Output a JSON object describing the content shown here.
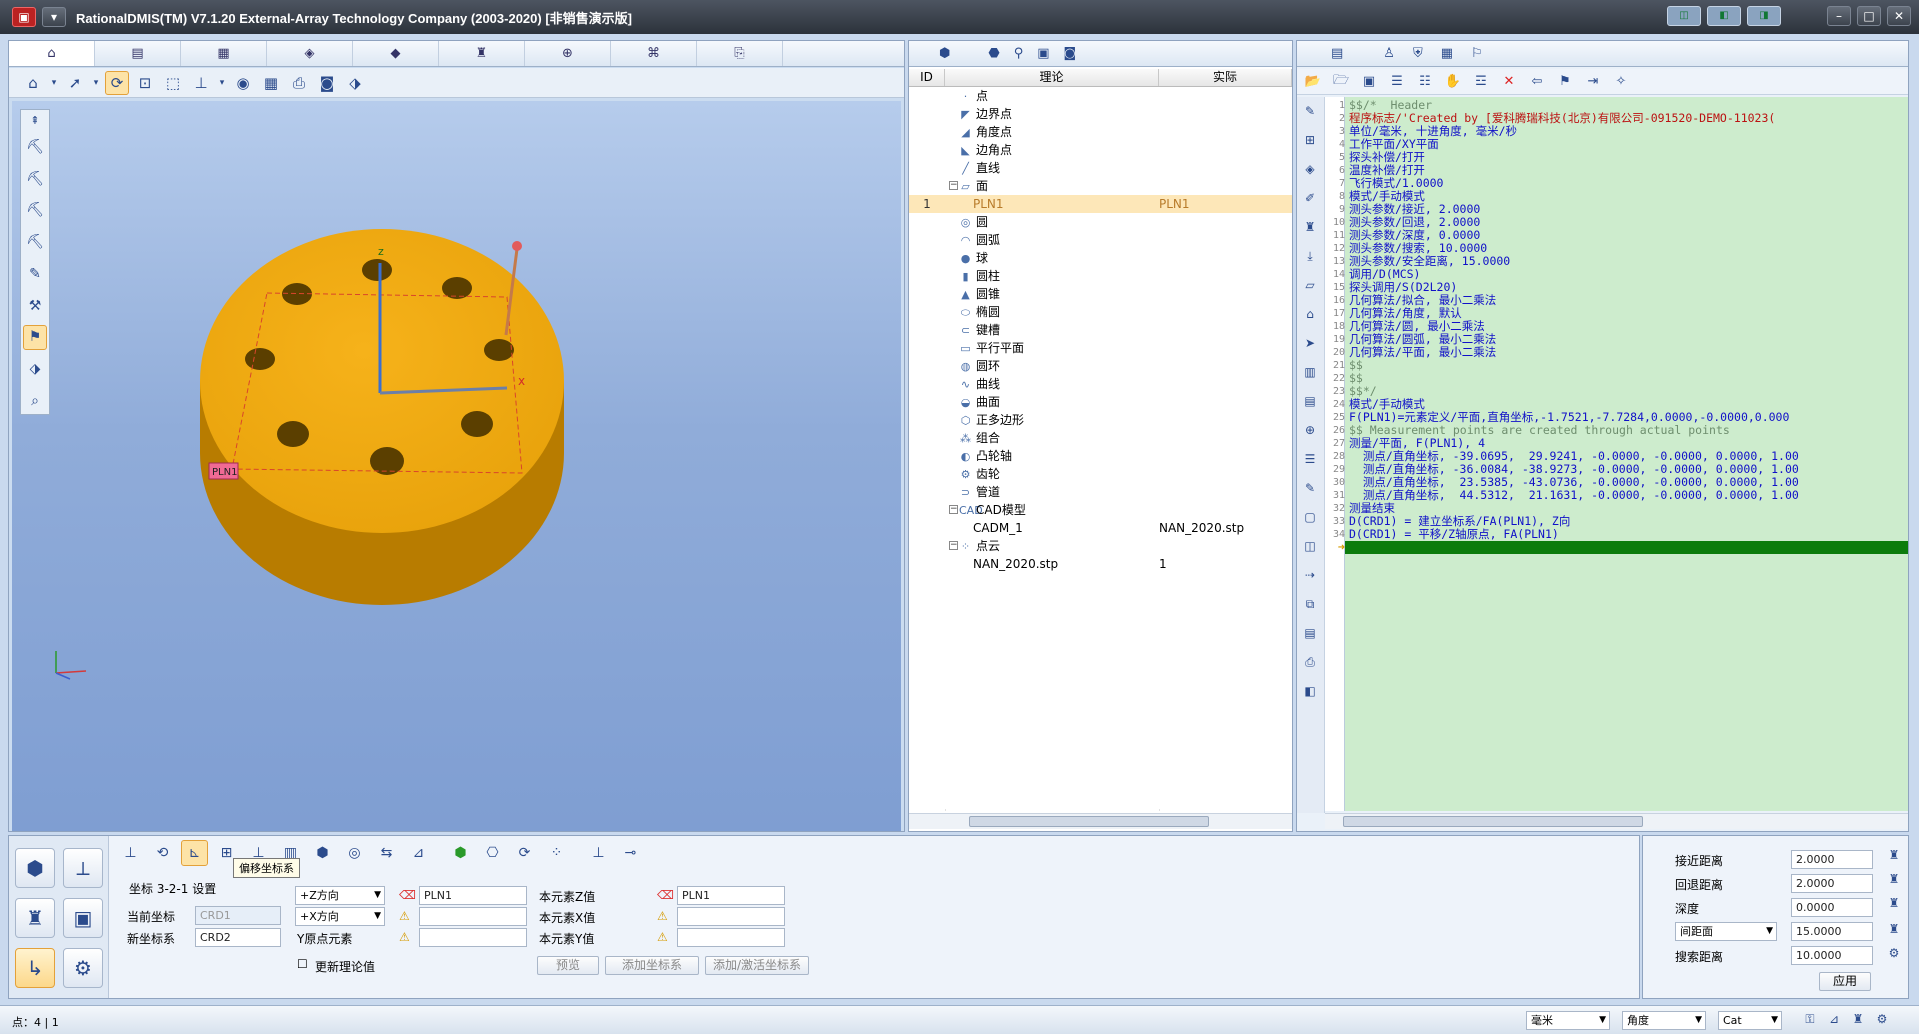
{
  "titlebar": {
    "title": "RationalDMIS(TM) V7.1.20    External-Array Technology Company (2003-2020) [非销售演示版]"
  },
  "left_tabs": [
    "⌂",
    "▤",
    "▦",
    "◈",
    "◆",
    "♜",
    "⊕",
    "⌘",
    "⎘"
  ],
  "viewport": {
    "plane_label": "PLN1",
    "axis_z": "z",
    "axis_x": "x"
  },
  "tooltip": "偏移坐标系",
  "tree": {
    "headers": {
      "id": "ID",
      "nominal": "理论",
      "actual": "实际"
    },
    "rows": [
      {
        "id": "",
        "name": "点",
        "icon": "·",
        "indent": 1,
        "actual": ""
      },
      {
        "id": "",
        "name": "边界点",
        "icon": "◤",
        "indent": 1,
        "actual": ""
      },
      {
        "id": "",
        "name": "角度点",
        "icon": "◢",
        "indent": 1,
        "actual": ""
      },
      {
        "id": "",
        "name": "边角点",
        "icon": "◣",
        "indent": 1,
        "actual": ""
      },
      {
        "id": "",
        "name": "直线",
        "icon": "╱",
        "indent": 1,
        "actual": ""
      },
      {
        "id": "",
        "name": "面",
        "icon": "▱",
        "indent": 1,
        "actual": "",
        "toggle": "-"
      },
      {
        "id": "1",
        "name": "PLN1",
        "icon": "",
        "indent": 2,
        "actual": "PLN1",
        "selected": true
      },
      {
        "id": "",
        "name": "圆",
        "icon": "◎",
        "indent": 1,
        "actual": ""
      },
      {
        "id": "",
        "name": "圆弧",
        "icon": "◠",
        "indent": 1,
        "actual": ""
      },
      {
        "id": "",
        "name": "球",
        "icon": "●",
        "indent": 1,
        "actual": ""
      },
      {
        "id": "",
        "name": "圆柱",
        "icon": "▮",
        "indent": 1,
        "actual": ""
      },
      {
        "id": "",
        "name": "圆锥",
        "icon": "▲",
        "indent": 1,
        "actual": ""
      },
      {
        "id": "",
        "name": "椭圆",
        "icon": "⬭",
        "indent": 1,
        "actual": ""
      },
      {
        "id": "",
        "name": "键槽",
        "icon": "⊂",
        "indent": 1,
        "actual": ""
      },
      {
        "id": "",
        "name": "平行平面",
        "icon": "▭",
        "indent": 1,
        "actual": ""
      },
      {
        "id": "",
        "name": "圆环",
        "icon": "◍",
        "indent": 1,
        "actual": ""
      },
      {
        "id": "",
        "name": "曲线",
        "icon": "∿",
        "indent": 1,
        "actual": ""
      },
      {
        "id": "",
        "name": "曲面",
        "icon": "◒",
        "indent": 1,
        "actual": ""
      },
      {
        "id": "",
        "name": "正多边形",
        "icon": "⬡",
        "indent": 1,
        "actual": ""
      },
      {
        "id": "",
        "name": "组合",
        "icon": "⁂",
        "indent": 1,
        "actual": ""
      },
      {
        "id": "",
        "name": "凸轮轴",
        "icon": "◐",
        "indent": 1,
        "actual": ""
      },
      {
        "id": "",
        "name": "齿轮",
        "icon": "⚙",
        "indent": 1,
        "actual": ""
      },
      {
        "id": "",
        "name": "管道",
        "icon": "⊃",
        "indent": 1,
        "actual": ""
      },
      {
        "id": "",
        "name": "CAD模型",
        "icon": "CAD",
        "indent": 1,
        "actual": "",
        "toggle": "-"
      },
      {
        "id": "",
        "name": "CADM_1",
        "icon": "",
        "indent": 2,
        "actual": "NAN_2020.stp"
      },
      {
        "id": "",
        "name": "点云",
        "icon": "⁘",
        "indent": 1,
        "actual": "",
        "toggle": "-"
      },
      {
        "id": "",
        "name": "NAN_2020.stp",
        "icon": "",
        "indent": 2,
        "actual": "1"
      }
    ]
  },
  "code": {
    "lines": [
      {
        "n": "1",
        "t": "$$/*  Header",
        "c": "cm"
      },
      {
        "n": "2",
        "t": "程序标志/'Created by [爱科腾瑞科技(北京)有限公司-091520-DEMO-11023(",
        "c": "st"
      },
      {
        "n": "3",
        "t": "单位/毫米, 十进角度, 毫米/秒",
        "c": "kw"
      },
      {
        "n": "4",
        "t": "工作平面/XY平面",
        "c": "kw"
      },
      {
        "n": "5",
        "t": "探头补偿/打开",
        "c": "kw"
      },
      {
        "n": "6",
        "t": "温度补偿/打开",
        "c": "kw"
      },
      {
        "n": "7",
        "t": "飞行模式/1.0000",
        "c": "kw"
      },
      {
        "n": "8",
        "t": "模式/手动模式",
        "c": "kw"
      },
      {
        "n": "9",
        "t": "测头参数/接近, 2.0000",
        "c": "kw"
      },
      {
        "n": "10",
        "t": "测头参数/回退, 2.0000",
        "c": "kw"
      },
      {
        "n": "11",
        "t": "测头参数/深度, 0.0000",
        "c": "kw"
      },
      {
        "n": "12",
        "t": "测头参数/搜索, 10.0000",
        "c": "kw"
      },
      {
        "n": "13",
        "t": "测头参数/安全距离, 15.0000",
        "c": "kw"
      },
      {
        "n": "14",
        "t": "调用/D(MCS)",
        "c": "kw"
      },
      {
        "n": "15",
        "t": "探头调用/S(D2L20)",
        "c": "kw"
      },
      {
        "n": "16",
        "t": "几何算法/拟合, 最小二乘法",
        "c": "kw"
      },
      {
        "n": "17",
        "t": "几何算法/角度, 默认",
        "c": "kw"
      },
      {
        "n": "18",
        "t": "几何算法/圆, 最小二乘法",
        "c": "kw"
      },
      {
        "n": "19",
        "t": "几何算法/圆弧, 最小二乘法",
        "c": "kw"
      },
      {
        "n": "20",
        "t": "几何算法/平面, 最小二乘法",
        "c": "kw"
      },
      {
        "n": "21",
        "t": "$$",
        "c": "cm"
      },
      {
        "n": "22",
        "t": "$$",
        "c": "cm"
      },
      {
        "n": "23",
        "t": "$$*/",
        "c": "cm"
      },
      {
        "n": "24",
        "t": "模式/手动模式",
        "c": "kw"
      },
      {
        "n": "25",
        "t": "F(PLN1)=元素定义/平面,直角坐标,-1.7521,-7.7284,0.0000,-0.0000,0.000",
        "c": "kw"
      },
      {
        "n": "26",
        "t": "$$ Measurement points are created through actual points",
        "c": "cm"
      },
      {
        "n": "27",
        "t": "测量/平面, F(PLN1), 4",
        "c": "kw"
      },
      {
        "n": "28",
        "t": "  测点/直角坐标, -39.0695,  29.9241, -0.0000, -0.0000, 0.0000, 1.00",
        "c": "kw"
      },
      {
        "n": "29",
        "t": "  测点/直角坐标, -36.0084, -38.9273, -0.0000, -0.0000, 0.0000, 1.00",
        "c": "kw"
      },
      {
        "n": "30",
        "t": "  测点/直角坐标,  23.5385, -43.0736, -0.0000, -0.0000, 0.0000, 1.00",
        "c": "kw"
      },
      {
        "n": "31",
        "t": "  测点/直角坐标,  44.5312,  21.1631, -0.0000, -0.0000, 0.0000, 1.00",
        "c": "kw"
      },
      {
        "n": "32",
        "t": "测量结束",
        "c": "kw"
      },
      {
        "n": "33",
        "t": "D(CRD1) = 建立坐标系/FA(PLN1), Z向",
        "c": "kw"
      },
      {
        "n": "34",
        "t": "D(CRD1) = 平移/Z轴原点, FA(PLN1)",
        "c": "kw"
      }
    ]
  },
  "bottom": {
    "section_label": "坐标 3-2-1 设置",
    "cur_crd_label": "当前坐标",
    "cur_crd_value": "CRD1",
    "new_crd_label": "新坐标系",
    "new_crd_value": "CRD2",
    "dir1": "+Z方向",
    "dir2": "+X方向",
    "y_origin_label": "Y原点元素",
    "elem1_value": "PLN1",
    "z_label": "本元素Z值",
    "x_label": "本元素X值",
    "y_label": "本元素Y值",
    "z_value": "PLN1",
    "update_label": "更新理论值",
    "btn_preview": "预览",
    "btn_add": "添加坐标系",
    "btn_add_activate": "添加/激活坐标系"
  },
  "probe": {
    "approach_label": "接近距离",
    "approach": "2.0000",
    "retract_label": "回退距离",
    "retract": "2.0000",
    "depth_label": "深度",
    "depth": "0.0000",
    "clearance_select": "间距面",
    "clearance": "15.0000",
    "search_label": "搜索距离",
    "search": "10.0000",
    "apply": "应用"
  },
  "status": {
    "left": "点：4 | 1",
    "unit": "毫米",
    "angle": "角度",
    "coord": "Cat"
  }
}
